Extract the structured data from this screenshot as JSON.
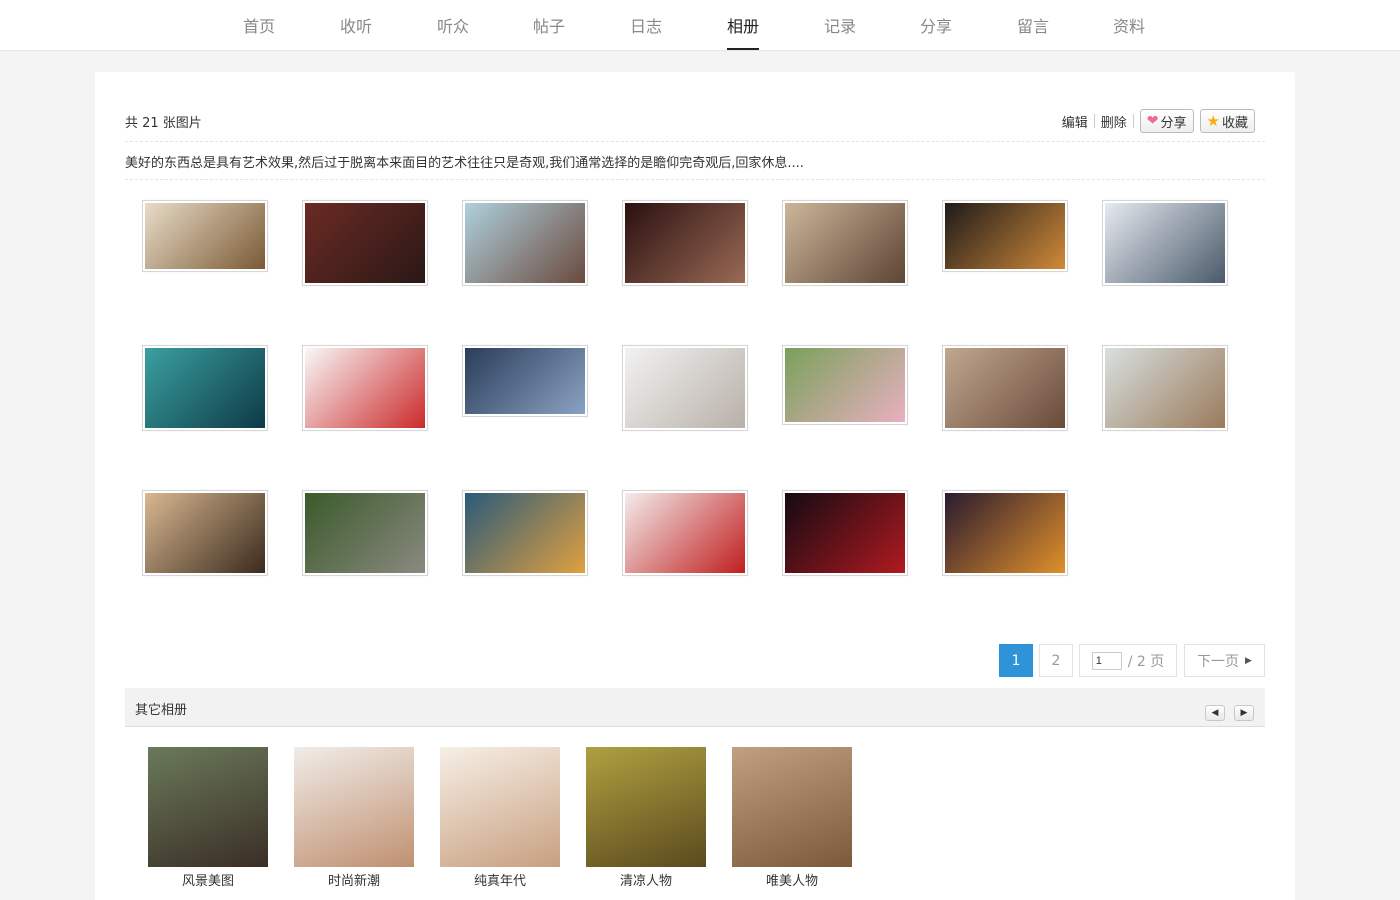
{
  "nav": {
    "items": [
      {
        "label": "首页",
        "active": false
      },
      {
        "label": "收听",
        "active": false
      },
      {
        "label": "听众",
        "active": false
      },
      {
        "label": "帖子",
        "active": false
      },
      {
        "label": "日志",
        "active": false
      },
      {
        "label": "相册",
        "active": true
      },
      {
        "label": "记录",
        "active": false
      },
      {
        "label": "分享",
        "active": false
      },
      {
        "label": "留言",
        "active": false
      },
      {
        "label": "资料",
        "active": false
      }
    ]
  },
  "album": {
    "count_text": "共 21 张图片",
    "edit_label": "编辑",
    "delete_label": "删除",
    "share_label": "分享",
    "share_icon": "heart-icon",
    "favorite_label": "收藏",
    "favorite_icon": "star-icon",
    "description": "美好的东西总是具有艺术效果,然后过于脱离本来面目的艺术往往只是奇观,我们通常选择的是瞻仰完奇观后,回家休息....",
    "photos": [
      {
        "colors": [
          "#e8dcc8",
          "#7a5a35"
        ]
      },
      {
        "colors": [
          "#6b2a24",
          "#2a1816"
        ]
      },
      {
        "colors": [
          "#aed0dc",
          "#6b4a3e"
        ]
      },
      {
        "colors": [
          "#2a1010",
          "#9a6a55"
        ]
      },
      {
        "colors": [
          "#cbb59a",
          "#5c4634"
        ]
      },
      {
        "colors": [
          "#1e1a1a",
          "#d08a3a"
        ]
      },
      {
        "colors": [
          "#e6eaf0",
          "#4a5a6a"
        ]
      },
      {
        "colors": [
          "#3aa0a0",
          "#0e3a46"
        ]
      },
      {
        "colors": [
          "#f8f8f8",
          "#cc2a2a"
        ]
      },
      {
        "colors": [
          "#2a3d5a",
          "#8aa2c2"
        ]
      },
      {
        "colors": [
          "#f2f2f2",
          "#b8b0a8"
        ]
      },
      {
        "colors": [
          "#7aa05a",
          "#e8b0c0"
        ]
      },
      {
        "colors": [
          "#c0a890",
          "#6a4a3a"
        ]
      },
      {
        "colors": [
          "#d8e0e0",
          "#9a7a5a"
        ]
      },
      {
        "colors": [
          "#d8b890",
          "#3a2a1e"
        ]
      },
      {
        "colors": [
          "#3a5a2a",
          "#8a8a80"
        ]
      },
      {
        "colors": [
          "#2a5a7a",
          "#e0a040"
        ]
      },
      {
        "colors": [
          "#f4ecec",
          "#c01e1e"
        ]
      },
      {
        "colors": [
          "#140a12",
          "#b01a20"
        ]
      },
      {
        "colors": [
          "#2a1a30",
          "#e0902a"
        ]
      }
    ]
  },
  "pagination": {
    "current": "1",
    "next_page": "2",
    "input_value": "1",
    "total_text": "/ 2 页",
    "next_label": "下一页"
  },
  "other_albums": {
    "title": "其它相册",
    "items": [
      {
        "name": "风景美图",
        "colors": [
          "#6a7a5a",
          "#3a2e26"
        ]
      },
      {
        "name": "时尚新潮",
        "colors": [
          "#f0ece8",
          "#c09070"
        ]
      },
      {
        "name": "纯真年代",
        "colors": [
          "#f6efe6",
          "#c8a080"
        ]
      },
      {
        "name": "清凉人物",
        "colors": [
          "#b0a040",
          "#5a4a1e"
        ]
      },
      {
        "name": "唯美人物",
        "colors": [
          "#c0a080",
          "#7a5a3a"
        ]
      }
    ]
  }
}
